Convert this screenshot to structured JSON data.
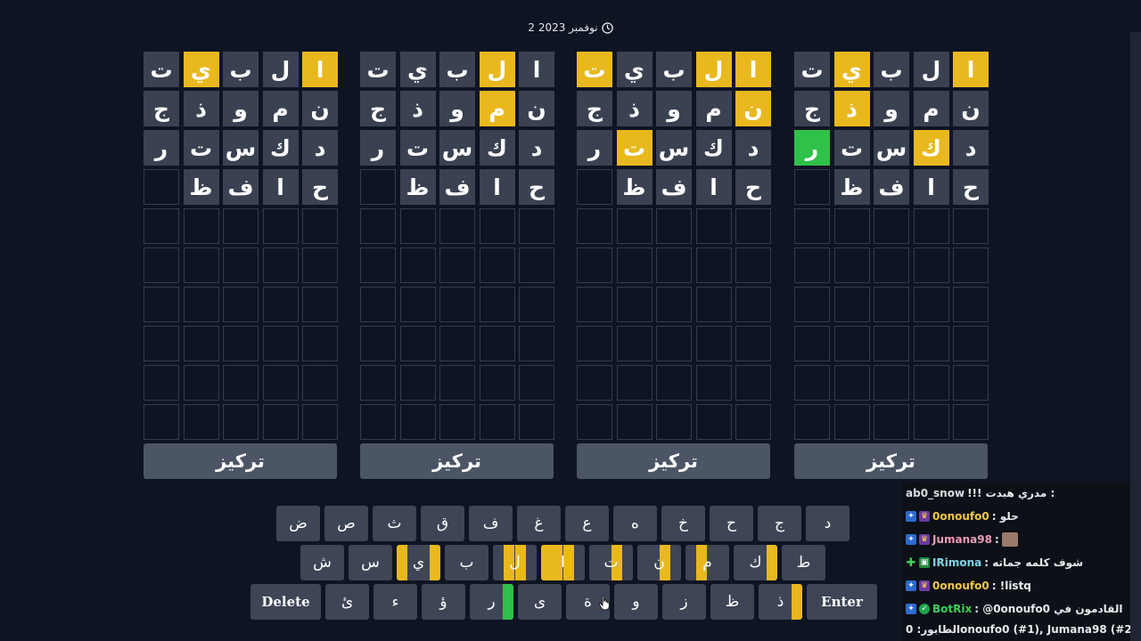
{
  "date": {
    "text": "2 نوفمبر 2023"
  },
  "boards": [
    {
      "focus_label": "تركيز",
      "rows": [
        [
          {
            "l": "ت",
            "s": "filled"
          },
          {
            "l": "ي",
            "s": "yellow"
          },
          {
            "l": "ب",
            "s": "filled"
          },
          {
            "l": "ل",
            "s": "filled"
          },
          {
            "l": "ا",
            "s": "yellow"
          }
        ],
        [
          {
            "l": "ج",
            "s": "filled"
          },
          {
            "l": "ذ",
            "s": "filled"
          },
          {
            "l": "و",
            "s": "filled"
          },
          {
            "l": "م",
            "s": "filled"
          },
          {
            "l": "ن",
            "s": "filled"
          }
        ],
        [
          {
            "l": "ر",
            "s": "filled"
          },
          {
            "l": "ت",
            "s": "filled"
          },
          {
            "l": "س",
            "s": "filled"
          },
          {
            "l": "ك",
            "s": "filled"
          },
          {
            "l": "د",
            "s": "filled"
          }
        ],
        [
          {
            "l": "",
            "s": "empty"
          },
          {
            "l": "ظ",
            "s": "filled"
          },
          {
            "l": "ف",
            "s": "filled"
          },
          {
            "l": "ا",
            "s": "filled"
          },
          {
            "l": "ح",
            "s": "filled"
          }
        ]
      ]
    },
    {
      "focus_label": "تركيز",
      "rows": [
        [
          {
            "l": "ت",
            "s": "filled"
          },
          {
            "l": "ي",
            "s": "filled"
          },
          {
            "l": "ب",
            "s": "filled"
          },
          {
            "l": "ل",
            "s": "yellow"
          },
          {
            "l": "ا",
            "s": "filled"
          }
        ],
        [
          {
            "l": "ج",
            "s": "filled"
          },
          {
            "l": "ذ",
            "s": "filled"
          },
          {
            "l": "و",
            "s": "filled"
          },
          {
            "l": "م",
            "s": "yellow"
          },
          {
            "l": "ن",
            "s": "filled"
          }
        ],
        [
          {
            "l": "ر",
            "s": "filled"
          },
          {
            "l": "ت",
            "s": "filled"
          },
          {
            "l": "س",
            "s": "filled"
          },
          {
            "l": "ك",
            "s": "filled"
          },
          {
            "l": "د",
            "s": "filled"
          }
        ],
        [
          {
            "l": "",
            "s": "empty"
          },
          {
            "l": "ظ",
            "s": "filled"
          },
          {
            "l": "ف",
            "s": "filled"
          },
          {
            "l": "ا",
            "s": "filled"
          },
          {
            "l": "ح",
            "s": "filled"
          }
        ]
      ]
    },
    {
      "focus_label": "تركيز",
      "rows": [
        [
          {
            "l": "ت",
            "s": "yellow"
          },
          {
            "l": "ي",
            "s": "filled"
          },
          {
            "l": "ب",
            "s": "filled"
          },
          {
            "l": "ل",
            "s": "yellow"
          },
          {
            "l": "ا",
            "s": "yellow"
          }
        ],
        [
          {
            "l": "ج",
            "s": "filled"
          },
          {
            "l": "ذ",
            "s": "filled"
          },
          {
            "l": "و",
            "s": "filled"
          },
          {
            "l": "م",
            "s": "filled"
          },
          {
            "l": "ن",
            "s": "yellow"
          }
        ],
        [
          {
            "l": "ر",
            "s": "filled"
          },
          {
            "l": "ت",
            "s": "yellow"
          },
          {
            "l": "س",
            "s": "filled"
          },
          {
            "l": "ك",
            "s": "filled"
          },
          {
            "l": "د",
            "s": "filled"
          }
        ],
        [
          {
            "l": "",
            "s": "empty"
          },
          {
            "l": "ظ",
            "s": "filled"
          },
          {
            "l": "ف",
            "s": "filled"
          },
          {
            "l": "ا",
            "s": "filled"
          },
          {
            "l": "ح",
            "s": "filled"
          }
        ]
      ]
    },
    {
      "focus_label": "تركيز",
      "rows": [
        [
          {
            "l": "ت",
            "s": "filled"
          },
          {
            "l": "ي",
            "s": "yellow"
          },
          {
            "l": "ب",
            "s": "filled"
          },
          {
            "l": "ل",
            "s": "filled"
          },
          {
            "l": "ا",
            "s": "yellow"
          }
        ],
        [
          {
            "l": "ج",
            "s": "filled"
          },
          {
            "l": "ذ",
            "s": "yellow"
          },
          {
            "l": "و",
            "s": "filled"
          },
          {
            "l": "م",
            "s": "filled"
          },
          {
            "l": "ن",
            "s": "filled"
          }
        ],
        [
          {
            "l": "ر",
            "s": "green"
          },
          {
            "l": "ت",
            "s": "filled"
          },
          {
            "l": "س",
            "s": "filled"
          },
          {
            "l": "ك",
            "s": "yellow"
          },
          {
            "l": "د",
            "s": "filled"
          }
        ],
        [
          {
            "l": "",
            "s": "empty"
          },
          {
            "l": "ظ",
            "s": "filled"
          },
          {
            "l": "ف",
            "s": "filled"
          },
          {
            "l": "ا",
            "s": "filled"
          },
          {
            "l": "ح",
            "s": "filled"
          }
        ]
      ]
    }
  ],
  "total_rows": 10,
  "keyboard": {
    "rows": [
      [
        {
          "l": "ض"
        },
        {
          "l": "ص"
        },
        {
          "l": "ث"
        },
        {
          "l": "ق"
        },
        {
          "l": "ف"
        },
        {
          "l": "غ"
        },
        {
          "l": "ع"
        },
        {
          "l": "ه"
        },
        {
          "l": "خ"
        },
        {
          "l": "ح"
        },
        {
          "l": "ج"
        },
        {
          "l": "د"
        }
      ],
      [
        {
          "l": "ش"
        },
        {
          "l": "س"
        },
        {
          "l": "ي",
          "q": [
            "y",
            "",
            "",
            "y"
          ]
        },
        {
          "l": "ب"
        },
        {
          "l": "ل",
          "q": [
            "",
            "y",
            "y",
            ""
          ]
        },
        {
          "l": "ا",
          "q": [
            "y",
            "y",
            "y",
            ""
          ]
        },
        {
          "l": "ت",
          "q": [
            "",
            "",
            "y",
            ""
          ]
        },
        {
          "l": "ن",
          "q": [
            "",
            "",
            "y",
            ""
          ]
        },
        {
          "l": "م",
          "q": [
            "",
            "y",
            "",
            ""
          ]
        },
        {
          "l": "ك",
          "q": [
            "",
            "",
            "",
            "y"
          ]
        },
        {
          "l": "ط"
        }
      ],
      [
        {
          "l": "Delete",
          "wide": true
        },
        {
          "l": "ئ"
        },
        {
          "l": "ء"
        },
        {
          "l": "ؤ"
        },
        {
          "l": "ر",
          "q": [
            "",
            "",
            "",
            "g"
          ]
        },
        {
          "l": "ى"
        },
        {
          "l": "ة"
        },
        {
          "l": "و"
        },
        {
          "l": "ز"
        },
        {
          "l": "ظ"
        },
        {
          "l": "ذ",
          "q": [
            "",
            "",
            "",
            "y"
          ]
        },
        {
          "l": "Enter",
          "wide": true
        }
      ]
    ]
  },
  "colors": {
    "yellow": "#e8b81e",
    "green": "#2fc14a",
    "tile": "#3a4252",
    "key": "#3d4556",
    "focus": "#4b5566",
    "background": "#0f1423"
  },
  "chat": [
    {
      "badges": [],
      "user": "ab0_snow",
      "user_color": "white",
      "message": "!!! مدري هبدت :"
    },
    {
      "badges": [
        "blue",
        "sub"
      ],
      "user": "0onoufo0",
      "user_color": "gold",
      "message": ": حلو"
    },
    {
      "badges": [
        "blue",
        "sub"
      ],
      "user": "Jumana98",
      "user_color": "pink",
      "message": ":",
      "emote": true
    },
    {
      "badges": [
        "green",
        "mod"
      ],
      "user": "IRimona",
      "user_color": "teal",
      "message": ": شوف كلمه جماته"
    },
    {
      "badges": [
        "blue",
        "sub"
      ],
      "user": "0onoufo0",
      "user_color": "gold",
      "message": ": !listq"
    },
    {
      "badges": [
        "blue",
        "chk"
      ],
      "user": "BotRix",
      "user_color": "green",
      "message": ": @0onoufo0 القادمون في"
    },
    {
      "badges": [],
      "user": "",
      "user_color": "white",
      "message": "الطابور: 0onoufo0 (#1), Jumana98 (#2)"
    }
  ]
}
